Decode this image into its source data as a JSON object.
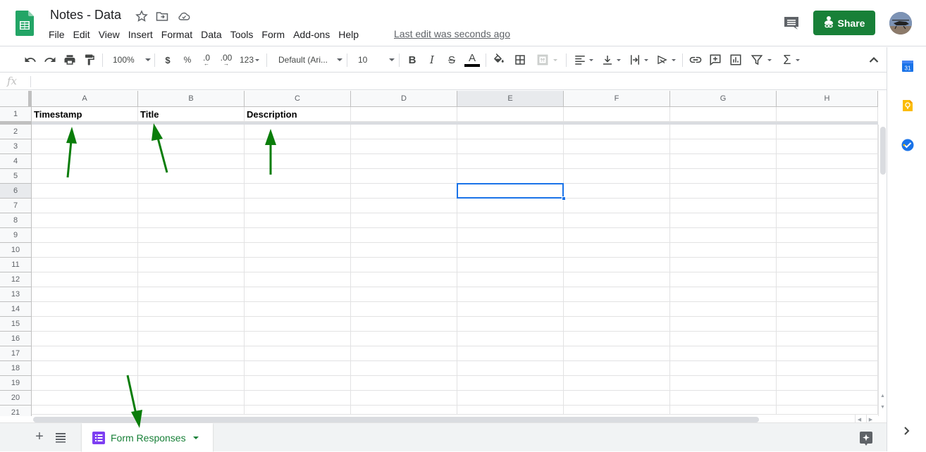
{
  "app": {
    "title": "Notes - Data",
    "last_edit": "Last edit was seconds ago",
    "share_label": "Share",
    "brand_color": "#188038",
    "selection_color": "#1a73e8"
  },
  "menu": [
    "File",
    "Edit",
    "View",
    "Insert",
    "Format",
    "Data",
    "Tools",
    "Form",
    "Add-ons",
    "Help"
  ],
  "toolbar": {
    "zoom": "100%",
    "currency": "$",
    "percent": "%",
    "decrease_decimal": ".0",
    "increase_decimal": ".00",
    "more_formats": "123",
    "font": "Default (Ari...",
    "font_size": "10",
    "bold": "B",
    "italic": "I",
    "strikethrough": "S",
    "text_color": "A",
    "sum": "Σ"
  },
  "formula_bar": {
    "fx_label": "fx",
    "value": ""
  },
  "grid": {
    "columns": [
      "A",
      "B",
      "C",
      "D",
      "E",
      "F",
      "G",
      "H"
    ],
    "rows": [
      "1",
      "2",
      "3",
      "4",
      "5",
      "6",
      "7",
      "8",
      "9",
      "10",
      "11",
      "12",
      "13",
      "14",
      "15",
      "16",
      "17",
      "18",
      "19",
      "20",
      "21"
    ],
    "header_row": [
      "Timestamp",
      "Title",
      "Description",
      "",
      "",
      "",
      "",
      ""
    ],
    "selected_cell": "E6",
    "frozen_rows": 1
  },
  "sheets": {
    "tabs": [
      {
        "label": "Form Responses",
        "active": true
      }
    ]
  },
  "side_panel": {
    "calendar_label": "31"
  }
}
